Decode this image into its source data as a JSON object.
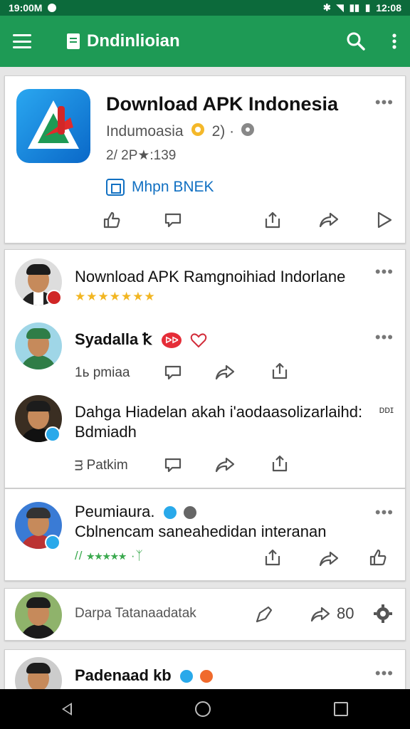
{
  "status_bar": {
    "time_left": "19:00M",
    "time_right": "12:08",
    "icons": [
      "bluetooth-icon",
      "wifi-icon",
      "signal-icon",
      "battery-icon"
    ]
  },
  "app_bar": {
    "title": "Dndinlioian",
    "icons": [
      "menu-icon",
      "document-icon",
      "search-icon",
      "more-vert-icon"
    ]
  },
  "app_card": {
    "name": "Download APK Indonesia",
    "developer": "Indumoasia",
    "developer_badge": "2) ·",
    "stats": "2/ 2P★:139",
    "install_label": "Mhpn BNEK",
    "actions": [
      "like-icon",
      "comment-icon",
      "share-icon",
      "forward-icon",
      "play-icon"
    ]
  },
  "posts": [
    {
      "text": "Nownload APK Ramgnoihiad Indorlane",
      "stars": "★★★★★★★"
    },
    {
      "name": "Syadalla",
      "suffix": "ꝁ",
      "badge": "ᐅᐅ",
      "time": "1ь pmiaa"
    },
    {
      "text_line1": "Dahga Hiadelan akah i'aodaasolizarlaihd:",
      "text_line2": "Bdmiadh",
      "suffix": "ᴅᴅɪ",
      "time": "ᴟ Patkim"
    },
    {
      "name": "Peumiaura.",
      "text": "Cblnencam saneahedidan interanan",
      "stars": "// ★★★★★ ·ᛉ"
    },
    {
      "name": "Darpa Tatanaadatak",
      "count": "80"
    },
    {
      "name": "Padenaad",
      "suffix": "kb"
    }
  ],
  "colors": {
    "app_bar": "#1e9a55",
    "status_bar": "#0c6a3b",
    "link": "#1170c2",
    "star": "#f2b622"
  }
}
